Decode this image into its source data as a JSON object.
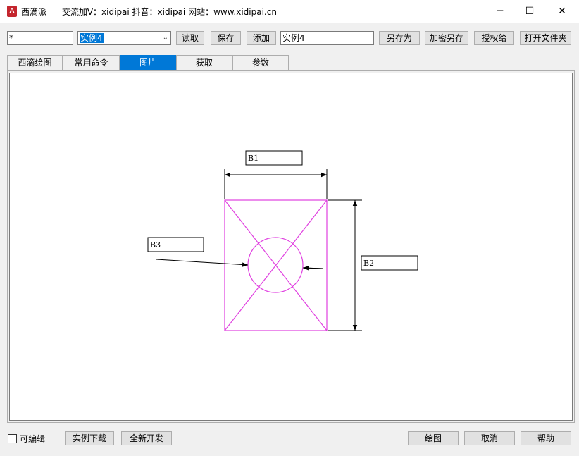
{
  "window": {
    "app_icon_letter": "A",
    "title": "西滴派",
    "contact": "交流加V：xidipai   抖音：xidipai   网站：www.xidipai.cn",
    "minimize": "─",
    "maximize": "☐",
    "close": "✕"
  },
  "toolbar": {
    "filter_value": "*",
    "combo_value": "实例4",
    "read_label": "读取",
    "save_label": "保存",
    "add_label": "添加",
    "name_value": "实例4",
    "saveas_label": "另存为",
    "encrypt_saveas_label": "加密另存",
    "authorize_label": "授权给",
    "open_folder_label": "打开文件夹"
  },
  "tabs": [
    {
      "label": "西滴绘图",
      "active": false
    },
    {
      "label": "常用命令",
      "active": false
    },
    {
      "label": "图片",
      "active": true
    },
    {
      "label": "获取",
      "active": false
    },
    {
      "label": "参数",
      "active": false
    }
  ],
  "drawing": {
    "labels": {
      "b1": "B1",
      "b2": "B2",
      "b3": "B3"
    },
    "colors": {
      "shape": "#e040e0",
      "dimension": "#000000"
    }
  },
  "footer": {
    "editable_label": "可编辑",
    "example_download_label": "实例下载",
    "new_dev_label": "全新开发",
    "draw_label": "绘图",
    "cancel_label": "取消",
    "help_label": "帮助"
  }
}
